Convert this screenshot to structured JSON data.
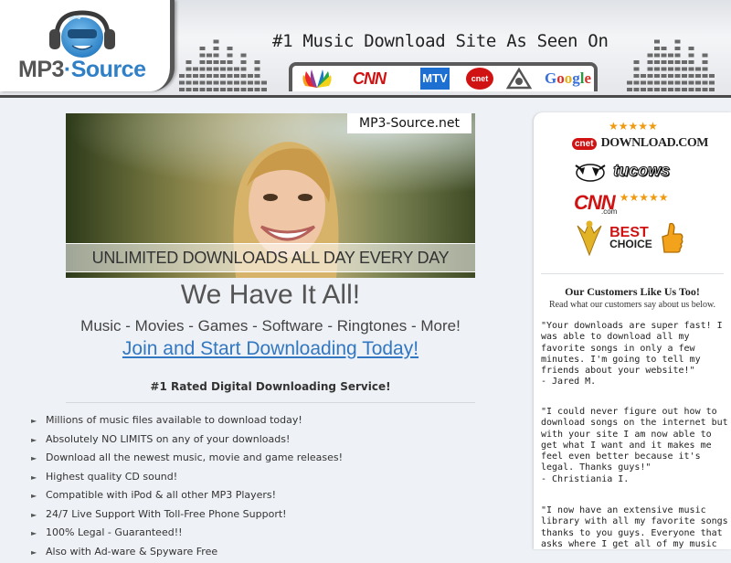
{
  "header": {
    "logo_text_main": "MP3",
    "logo_text_accent": "·Source",
    "tagline": "#1 Music Download Site As Seen On",
    "media": {
      "cnn": "CNN",
      "mtv": "MTV",
      "cnet": "cnet",
      "google": "Google"
    }
  },
  "hero": {
    "brand": "MP3-Source.net",
    "banner": "UNLIMITED DOWNLOADS ALL DAY EVERY DAY"
  },
  "main": {
    "headline": "We Have It All!",
    "subheadline": "Music - Movies - Games - Software - Ringtones - More!",
    "cta": "Join and Start Downloading Today!",
    "rated": "#1 Rated Digital Downloading Service!",
    "features": [
      "Millions of music files available to download today!",
      "Absolutely NO LIMITS on any of your downloads!",
      "Download all the newest music, movie and game releases!",
      "Highest quality CD sound!",
      "Compatible with iPod & all other MP3 Players!",
      "24/7 Live Support With Toll-Free Phone Support!",
      "100% Legal - Guaranteed!!",
      "Also with Ad-ware & Spyware Free"
    ]
  },
  "sidebar": {
    "awards": {
      "download_cnet": "cnet",
      "download_label": "DOWNLOAD.COM",
      "tucows": "tucows",
      "cnn": "CNN",
      "cnn_com": ".com",
      "best": "BEST",
      "choice": "CHOICE",
      "stars": "★★★★★"
    },
    "title": "Our Customers Like Us Too!",
    "subtitle": "Read what our customers say about us below.",
    "testimonials": [
      {
        "quote": "\"Your downloads are super fast! I was able to download all my favorite songs in only a few minutes. I'm going to tell my friends about your website!\"",
        "author": "- Jared M."
      },
      {
        "quote": "\"I could never figure out how to download songs on the internet but with your site I am now able to get what I want and it makes me feel even better because it's legal. Thanks guys!\"",
        "author": "- Christiania I."
      },
      {
        "quote": "\"I now have an extensive music library with all my favorite songs thanks to you guys. Everyone that asks where I get all of my music",
        "author": ""
      }
    ]
  },
  "colors": {
    "accent": "#2f80c7",
    "link": "#3277c1",
    "star": "#f09a10",
    "cnn_red": "#d01212"
  }
}
